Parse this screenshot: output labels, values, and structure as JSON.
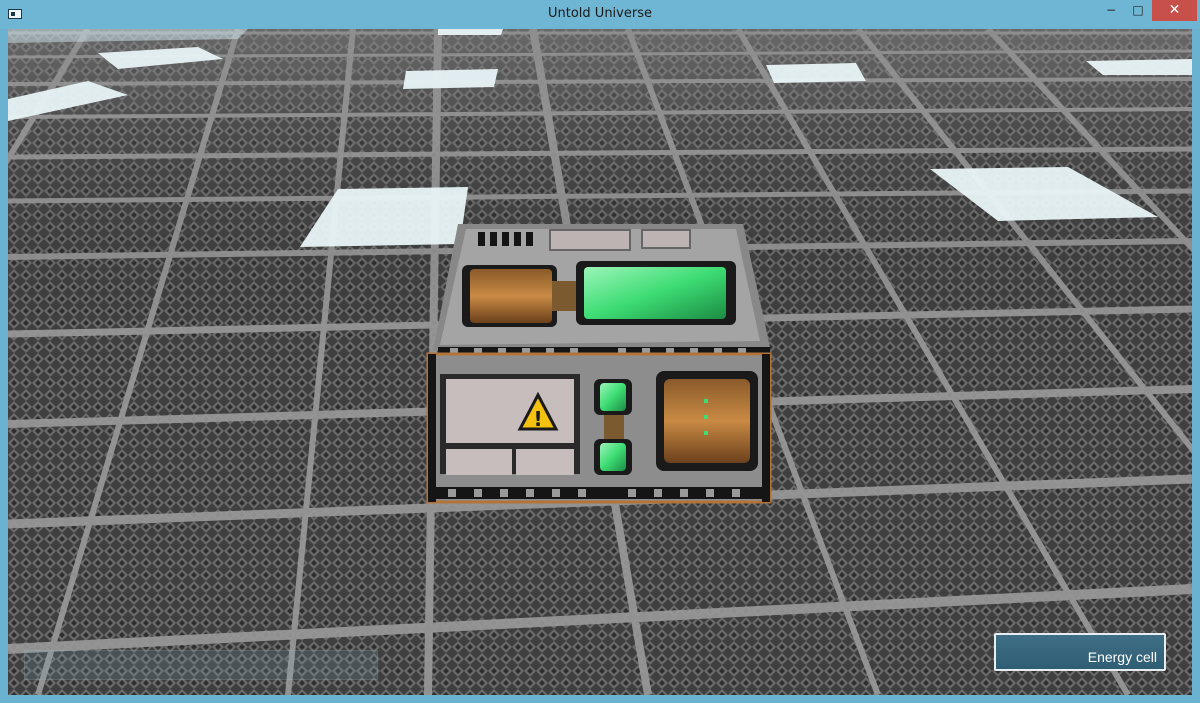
{
  "window": {
    "title": "Untold Universe",
    "controls": {
      "minimize": "−",
      "maximize": "□",
      "close": "✕"
    }
  },
  "scene": {
    "object": "energy cell block",
    "warning_symbol": "!",
    "colors": {
      "floor_tile": "#4a4a4a",
      "grid_line": "#8c8c8c",
      "light_panel": "#e8f4f7",
      "cell_glow": "#41e07a",
      "casing": "#8e8e8e",
      "warning": "#f2c20f"
    }
  },
  "hud": {
    "selected_item": "Energy cell"
  }
}
